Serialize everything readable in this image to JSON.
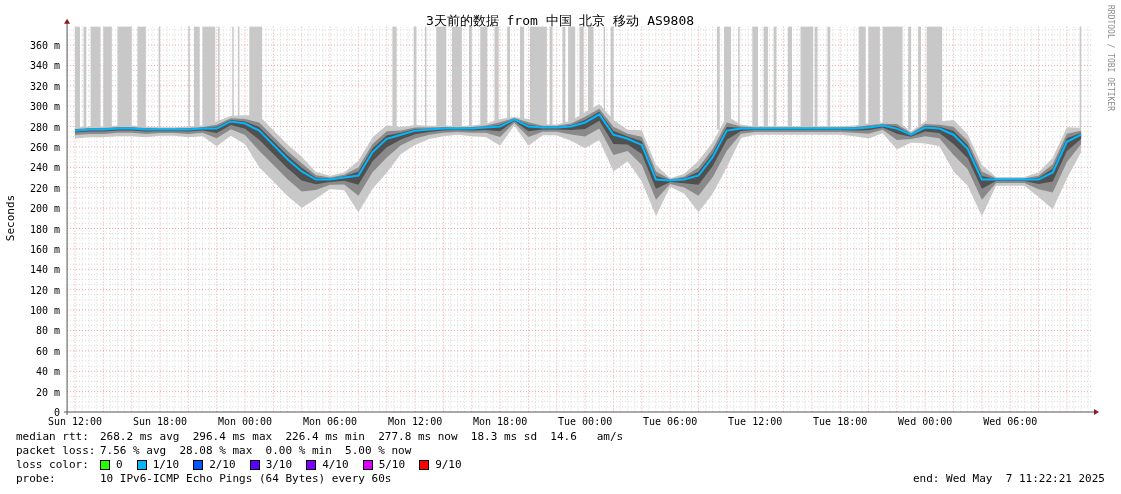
{
  "graph": {
    "credit": "RRDTOOL / TOBI OETIKER",
    "chart_data": {
      "type": "line",
      "title": "3天前的数据 from 中国 北京 移动 AS9808",
      "ylabel": "Seconds",
      "grid": true,
      "ylim": [
        0,
        378
      ],
      "categories": [
        "Sun 12:00",
        null,
        null,
        null,
        null,
        null,
        "Sun 18:00",
        null,
        null,
        null,
        null,
        null,
        "Mon 00:00",
        null,
        null,
        null,
        null,
        null,
        "Mon 06:00",
        null,
        null,
        null,
        null,
        null,
        "Mon 12:00",
        null,
        null,
        null,
        null,
        null,
        "Mon 18:00",
        null,
        null,
        null,
        null,
        null,
        "Tue 00:00",
        null,
        null,
        null,
        null,
        null,
        "Tue 06:00",
        null,
        null,
        null,
        null,
        null,
        "Tue 12:00",
        null,
        null,
        null,
        null,
        null,
        "Tue 18:00",
        null,
        null,
        null,
        null,
        null,
        "Wed 00:00",
        null,
        null,
        null,
        null,
        null,
        "Wed 06:00",
        null,
        null,
        null,
        null,
        null
      ],
      "yticks": [
        {
          "value": 0,
          "label": "0"
        },
        {
          "value": 20,
          "label": "20 m"
        },
        {
          "value": 40,
          "label": "40 m"
        },
        {
          "value": 60,
          "label": "60 m"
        },
        {
          "value": 80,
          "label": "80 m"
        },
        {
          "value": 100,
          "label": "100 m"
        },
        {
          "value": 120,
          "label": "120 m"
        },
        {
          "value": 140,
          "label": "140 m"
        },
        {
          "value": 160,
          "label": "160 m"
        },
        {
          "value": 180,
          "label": "180 m"
        },
        {
          "value": 200,
          "label": "200 m"
        },
        {
          "value": 220,
          "label": "220 m"
        },
        {
          "value": 240,
          "label": "240 m"
        },
        {
          "value": 260,
          "label": "260 m"
        },
        {
          "value": 280,
          "label": "280 m"
        },
        {
          "value": 300,
          "label": "300 m"
        },
        {
          "value": 320,
          "label": "320 m"
        },
        {
          "value": 340,
          "label": "340 m"
        },
        {
          "value": 360,
          "label": "360 m"
        }
      ],
      "series": [
        {
          "color": "#00b8ff",
          "values": [
            276,
            277,
            277,
            278,
            278,
            277,
            277,
            277,
            277,
            278,
            278,
            285,
            283,
            276,
            262,
            248,
            236,
            228,
            228,
            230,
            232,
            255,
            268,
            272,
            276,
            277,
            278,
            278,
            278,
            279,
            280,
            287,
            280,
            279,
            279,
            280,
            284,
            292,
            272,
            268,
            262,
            228,
            227,
            228,
            232,
            250,
            276,
            278,
            278,
            278,
            278,
            278,
            278,
            278,
            278,
            278,
            279,
            281,
            278,
            272,
            279,
            278,
            272,
            258,
            228,
            228,
            228,
            228,
            228,
            235,
            265,
            272
          ]
        }
      ],
      "data_labels": false
    }
  },
  "legend_rows": [
    {
      "kind": "text",
      "label": "median rtt:",
      "value": "268.2 ms avg  296.4 ms max  226.4 ms min  277.8 ms now  18.3 ms sd  14.6   am/s"
    },
    {
      "kind": "text",
      "label": "packet loss:",
      "value": "7.56 % avg  28.08 % max  0.00 % min  5.00 % now"
    },
    {
      "kind": "colors",
      "label": "loss color:",
      "items": [
        {
          "label": "0",
          "color": "#26ff00"
        },
        {
          "label": "1/10",
          "color": "#00b8ff"
        },
        {
          "label": "2/10",
          "color": "#0059ff"
        },
        {
          "label": "3/10",
          "color": "#5e00ff"
        },
        {
          "label": "4/10",
          "color": "#7e00ff"
        },
        {
          "label": "5/10",
          "color": "#dd00ff"
        },
        {
          "label": "9/10",
          "color": "#ff0000"
        }
      ]
    },
    {
      "kind": "probe",
      "label": "probe:",
      "value": "10 IPv6-ICMP Echo Pings (64 Bytes) every 60s",
      "end": "end: Wed May  7 11:22:21 2025"
    }
  ]
}
